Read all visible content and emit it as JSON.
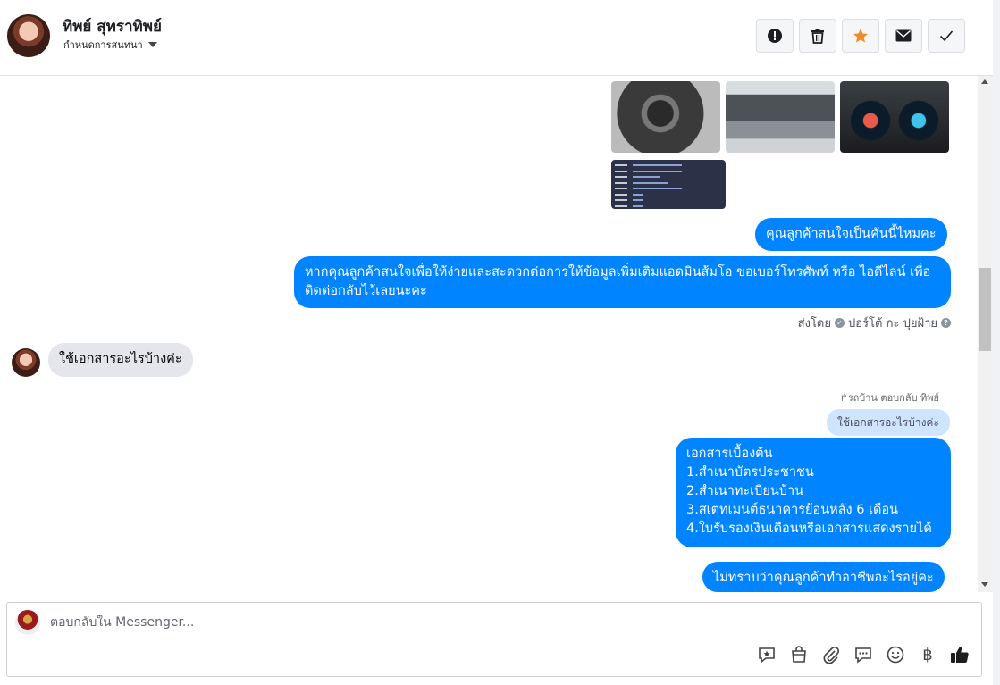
{
  "header": {
    "contact_name": "ทิพย์ สุทราทิพย์",
    "assign_label": "กำหนดการสนทนา",
    "actions": [
      {
        "name": "spam-button",
        "icon": "exclamation-icon"
      },
      {
        "name": "delete-button",
        "icon": "trash-icon"
      },
      {
        "name": "star-button",
        "icon": "star-icon",
        "color": "#f08c26"
      },
      {
        "name": "mark-unread-button",
        "icon": "envelope-icon"
      },
      {
        "name": "mark-done-button",
        "icon": "check-icon"
      }
    ]
  },
  "messages": {
    "out1": "คุณลูกค้าสนใจเป็นคันนี้ไหมคะ",
    "out2": "หากคุณลูกค้าสนใจเพื่อให้ง่ายและสะดวกต่อการให้ข้อมูลเพิ่มเติมแอดมินส้มโอ ขอเบอร์โทรศัพท์ หรือ ไอดีไลน์ เพื่อติดต่อกลับไว้เลยนะคะ",
    "sent_by_prefix": "ส่งโดย",
    "sent_by_name": "ปอร์โต้ กะ ปุยฝ้าย",
    "in1": "ใช้เอกสารอะไรบ้างค่ะ",
    "replied_note": "รถบ้าน ตอบกลับ ทิพย์",
    "reply_quote": "ใช้เอกสารอะไรบ้างค่ะ",
    "out3_lines": [
      "เอกสารเบื้องต้น",
      "1.สำเนาบัตรประชาชน",
      "2.สำเนาทะเบียนบ้าน",
      "3.สเตทเมนต์ธนาคารย้อนหลัง 6 เดือน",
      "4.ใบรับรองเงินเดือนหรือเอกสารแสดงรายได้"
    ],
    "out4": "ไม่ทราบว่าคุณลูกค้าทำอาชีพอะไรอยู่คะ"
  },
  "composer": {
    "placeholder": "ตอบกลับใน Messenger...",
    "tools": [
      "saved-reply-icon",
      "shop-icon",
      "attachment-icon",
      "chat-bubble-icon",
      "emoji-icon",
      "baht-icon",
      "thumbs-up-icon"
    ]
  },
  "colors": {
    "outgoing_bubble": "#0084ff",
    "incoming_bubble": "#e4e6eb",
    "reply_quote_bg": "#cfe5ff",
    "star": "#f08c26"
  }
}
